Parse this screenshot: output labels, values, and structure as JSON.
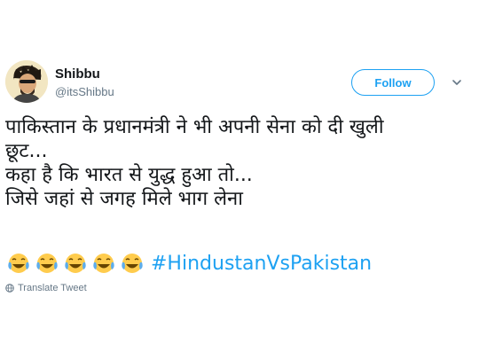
{
  "user": {
    "name": "Shibbu",
    "handle": "@itsShibbu"
  },
  "follow_label": "Follow",
  "tweet": {
    "lines": [
      "पाकिस्तान के प्रधानमंत्री ने भी अपनी सेना को दी खुली",
      "छूट...",
      "कहा है कि भारत से युद्ध हुआ तो...",
      "जिसे जहां से जगह मिले भाग लेना"
    ],
    "emoji": [
      "😂",
      "😂",
      "😂",
      "😂",
      "😂"
    ],
    "hashtag": "#HindustanVsPakistan"
  },
  "translate_label": "Translate Tweet",
  "icons": {
    "caret": "chevron-down-icon",
    "translate": "globe-icon",
    "emoji": "face-with-tears-of-joy"
  },
  "colors": {
    "accent": "#1da1f2",
    "text": "#14171a",
    "muted": "#657786"
  }
}
